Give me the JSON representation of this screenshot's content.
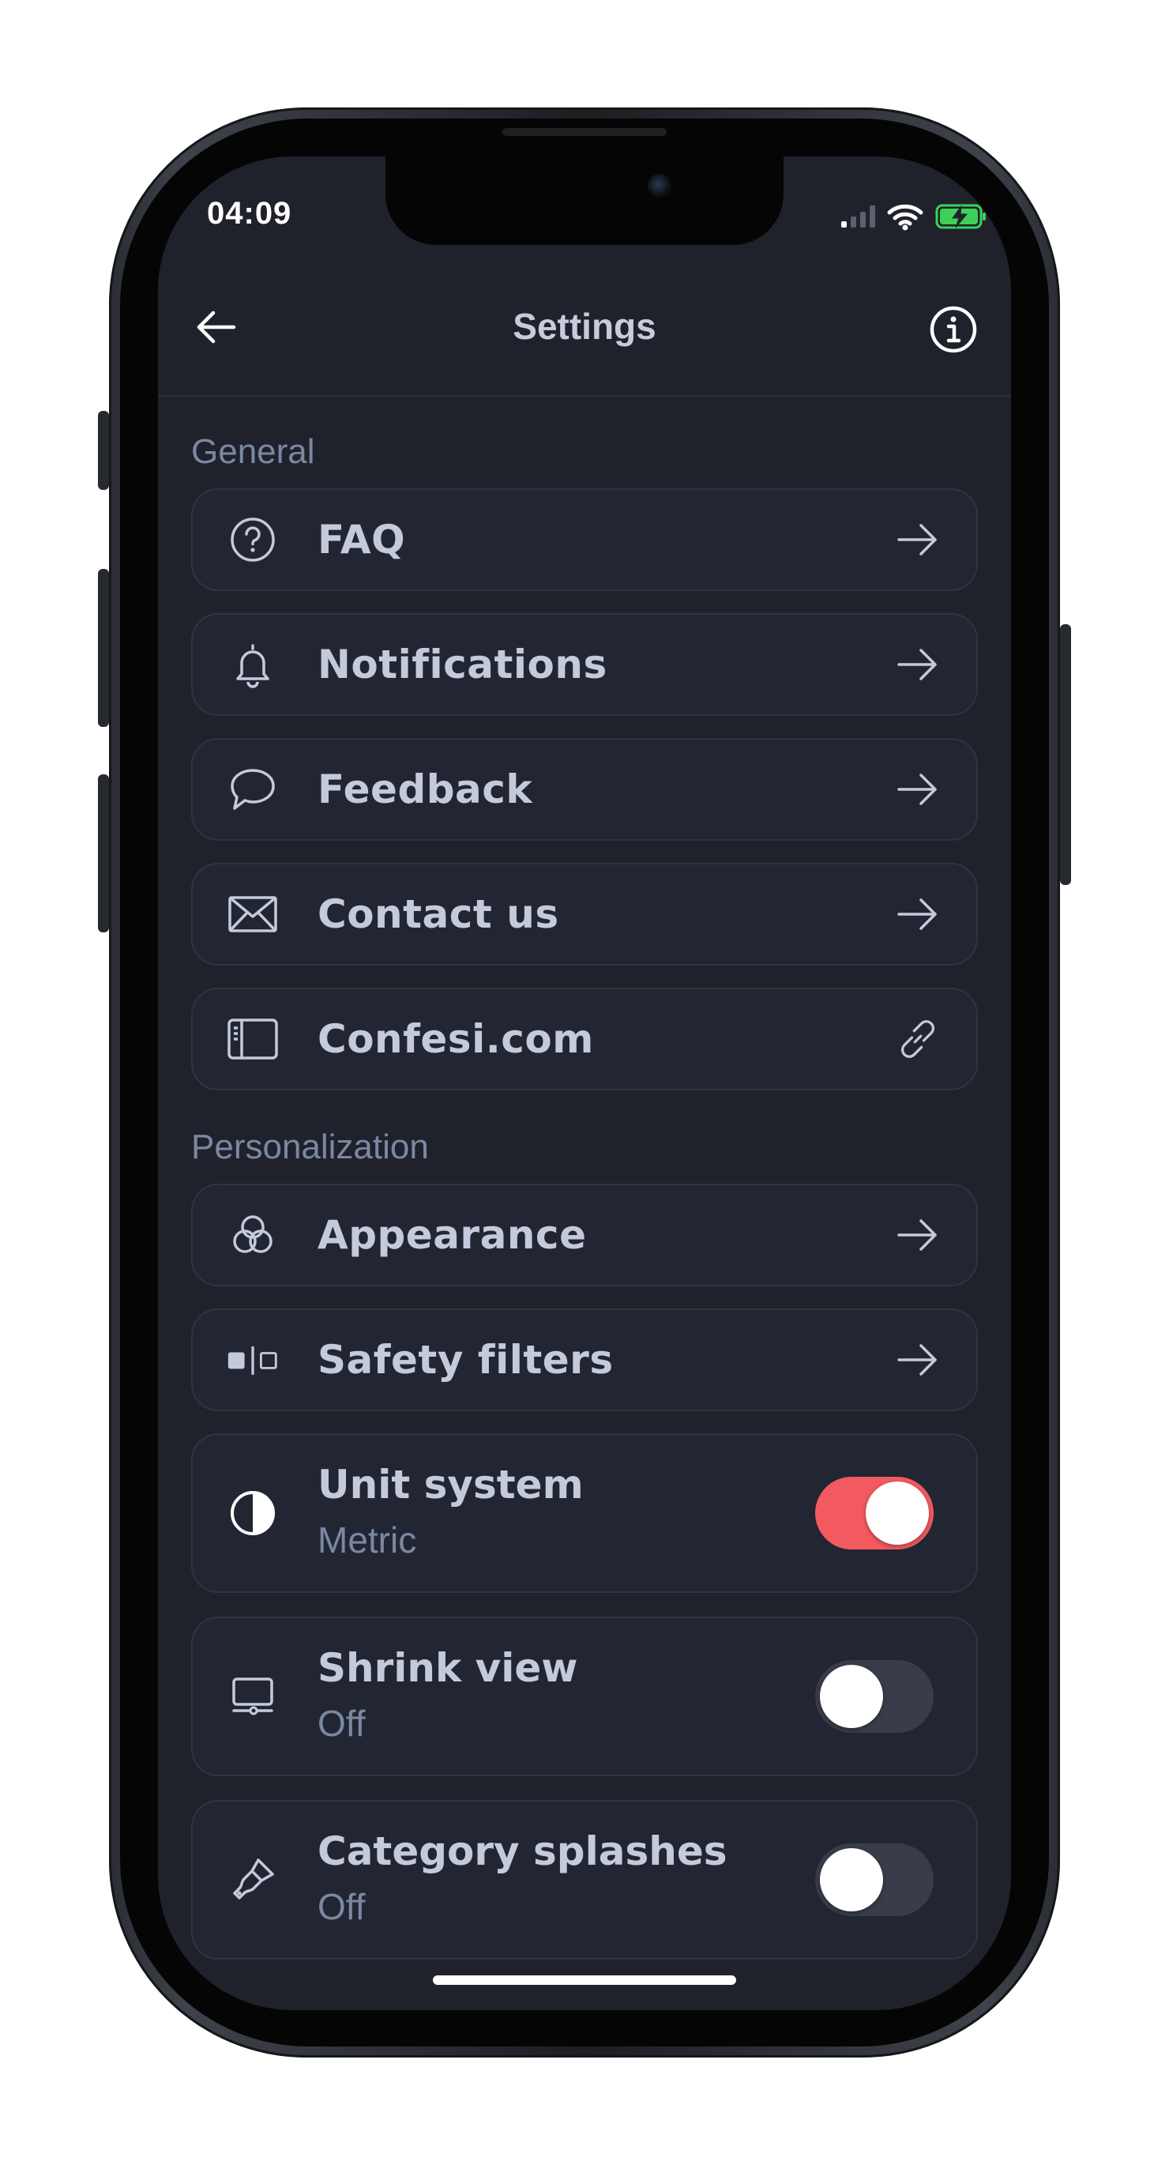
{
  "status_bar": {
    "time": "04:09"
  },
  "header": {
    "title": "Settings"
  },
  "sections": [
    {
      "label": "General",
      "items": [
        {
          "label": "FAQ",
          "icon": "help-circle-icon",
          "action": "arrow-right-icon"
        },
        {
          "label": "Notifications",
          "icon": "bell-icon",
          "action": "arrow-right-icon"
        },
        {
          "label": "Feedback",
          "icon": "chat-bubble-icon",
          "action": "arrow-right-icon"
        },
        {
          "label": "Contact us",
          "icon": "mail-icon",
          "action": "arrow-right-icon"
        },
        {
          "label": "Confesi.com",
          "icon": "sidebar-panel-icon",
          "action": "link-icon"
        }
      ]
    },
    {
      "label": "Personalization",
      "items": [
        {
          "label": "Appearance",
          "icon": "color-circles-icon",
          "action": "arrow-right-icon"
        },
        {
          "label": "Safety filters",
          "icon": "filter-boxes-icon",
          "action": "arrow-right-icon"
        },
        {
          "label": "Unit system",
          "value": "Metric",
          "icon": "half-circle-icon",
          "toggle": true,
          "toggle_on": true
        },
        {
          "label": "Shrink view",
          "value": "Off",
          "icon": "monitor-icon",
          "toggle": true,
          "toggle_on": false
        },
        {
          "label": "Category splashes",
          "value": "Off",
          "icon": "paint-brush-icon",
          "toggle": true,
          "toggle_on": false
        }
      ]
    }
  ],
  "colors": {
    "screen_bg": "#1f222b",
    "row_bg": "#222632",
    "row_border": "#2f3441",
    "text_primary": "#c4cadc",
    "text_secondary": "#7b88a3",
    "toggle_on": "#f25a5f",
    "toggle_off": "#393d49",
    "battery": "#3dd15a"
  }
}
